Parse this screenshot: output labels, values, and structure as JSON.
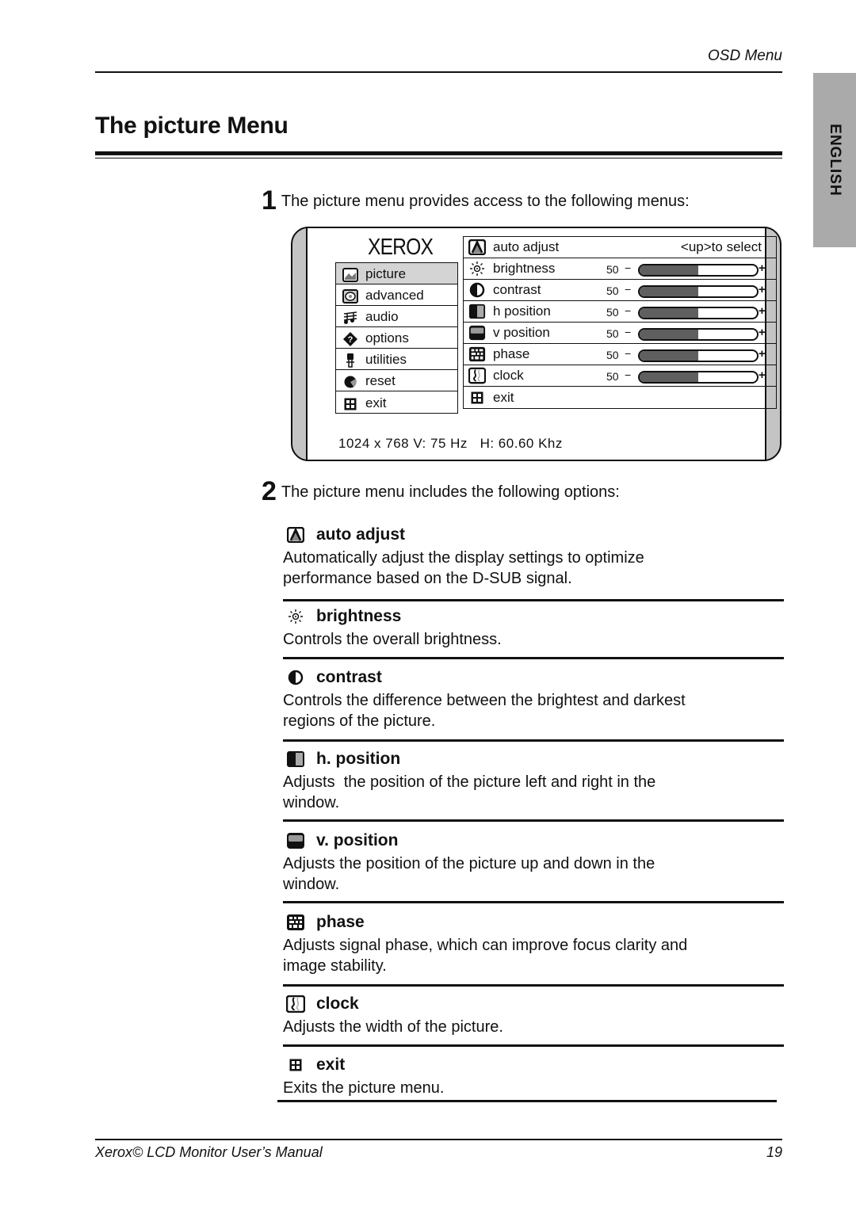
{
  "header": {
    "running_title": "OSD Menu",
    "section_tab": "ENGLISH"
  },
  "page_title": "The picture Menu",
  "step1": {
    "number": "1",
    "text": "The picture menu provides access to the following menus:"
  },
  "osd": {
    "logo": "XEROX",
    "main_menu": [
      {
        "label": "picture",
        "icon": "picture-icon",
        "active": true
      },
      {
        "label": "advanced",
        "icon": "advanced-icon"
      },
      {
        "label": "audio",
        "icon": "audio-icon"
      },
      {
        "label": "options",
        "icon": "options-icon"
      },
      {
        "label": "utilities",
        "icon": "utilities-icon"
      },
      {
        "label": "reset",
        "icon": "reset-icon"
      },
      {
        "label": "exit",
        "icon": "exit-icon"
      }
    ],
    "sub_menu": [
      {
        "label": "auto adjust",
        "icon": "auto-adjust-icon",
        "hint": "<up>to select"
      },
      {
        "label": "brightness",
        "icon": "brightness-icon",
        "value": "50",
        "level": 0.5,
        "minus": "−",
        "plus": "+"
      },
      {
        "label": "contrast",
        "icon": "contrast-icon",
        "value": "50",
        "level": 0.5,
        "minus": "−",
        "plus": "+"
      },
      {
        "label": "h position",
        "icon": "h-position-icon",
        "value": "50",
        "level": 0.5,
        "minus": "−",
        "plus": "+"
      },
      {
        "label": "v position",
        "icon": "v-position-icon",
        "value": "50",
        "level": 0.5,
        "minus": "−",
        "plus": "+"
      },
      {
        "label": "phase",
        "icon": "phase-icon",
        "value": "50",
        "level": 0.5,
        "minus": "−",
        "plus": "+"
      },
      {
        "label": "clock",
        "icon": "clock-icon",
        "value": "50",
        "level": 0.5,
        "minus": "−",
        "plus": "+"
      },
      {
        "label": "exit",
        "icon": "exit-icon"
      }
    ],
    "status": "1024 x 768 V: 75 Hz   H: 60.60 Khz"
  },
  "step2": {
    "number": "2",
    "text": "The picture menu includes the following options:"
  },
  "options": [
    {
      "title": "auto adjust",
      "icon": "auto-adjust-icon",
      "desc": [
        "Automatically adjust the display settings to optimize",
        "performance based on the D-SUB signal."
      ]
    },
    {
      "title": "brightness",
      "icon": "brightness-icon",
      "desc": [
        "Controls the overall brightness."
      ]
    },
    {
      "title": "contrast",
      "icon": "contrast-icon",
      "desc": [
        "Controls the difference between the brightest and darkest",
        "regions of the picture."
      ]
    },
    {
      "title": "h. position",
      "icon": "h-position-icon",
      "desc": [
        "Adjusts  the position of the picture left and right in the",
        "window."
      ]
    },
    {
      "title": "v. position",
      "icon": "v-position-icon",
      "desc": [
        "Adjusts the position of the picture up and down in the",
        "window."
      ]
    },
    {
      "title": "phase",
      "icon": "phase-icon",
      "desc": [
        "Adjusts signal phase, which can improve focus clarity and",
        "image stability."
      ]
    },
    {
      "title": "clock",
      "icon": "clock-icon",
      "desc": [
        "Adjusts the width of the picture."
      ]
    },
    {
      "title": "exit",
      "icon": "exit-icon",
      "desc": [
        "Exits the picture menu."
      ]
    }
  ],
  "footer": {
    "manual_title": "Xerox© LCD Monitor User’s Manual",
    "page_number": "19"
  },
  "colors": {
    "tab_gray": "#aaaaaa",
    "bezel_gray": "#c4c4c4",
    "active_item": "#d4d4d4",
    "bar_fill": "#5f5f5f"
  }
}
